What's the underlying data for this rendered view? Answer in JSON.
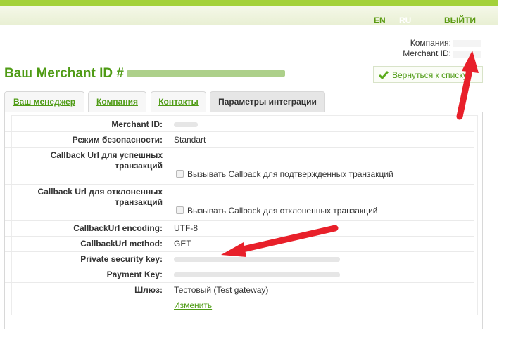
{
  "header": {
    "lang_en": "EN",
    "lang_ru": "RU",
    "logout": "ВЫЙТИ"
  },
  "account": {
    "company_label": "Компания:",
    "merchant_label": "Merchant ID:"
  },
  "page": {
    "title": "Ваш Merchant ID #"
  },
  "back_button": {
    "label": "Вернуться к списку",
    "icon": "check-icon"
  },
  "tabs": [
    {
      "label": "Ваш менеджер",
      "active": false
    },
    {
      "label": "Компания",
      "active": false
    },
    {
      "label": "Контакты",
      "active": false
    },
    {
      "label": "Параметры интеграции",
      "active": true
    }
  ],
  "fields": {
    "merchant_id": {
      "label": "Merchant ID:"
    },
    "security_mode": {
      "label": "Режим безопасности:",
      "value": "Standart"
    },
    "callback_success": {
      "label": "Callback Url для успешных транзакций",
      "checkbox_label": "Вызывать Callback для подтвержденных транзакций",
      "checked": false
    },
    "callback_fail": {
      "label": "Callback Url для отклоненных транзакций",
      "checkbox_label": "Вызывать Callback для отклоненных транзакций",
      "checked": false
    },
    "callback_encoding": {
      "label": "CallbackUrl encoding:",
      "value": "UTF-8"
    },
    "callback_method": {
      "label": "CallbackUrl method:",
      "value": "GET"
    },
    "private_key": {
      "label": "Private security key:"
    },
    "payment_key": {
      "label": "Payment Key:"
    },
    "gateway": {
      "label": "Шлюз:",
      "value": "Тестовый (Test gateway)"
    },
    "edit_link": "Изменить"
  },
  "colors": {
    "accent_green": "#4f9b15",
    "top_strip": "#a3d139",
    "annotation_red": "#e8202a"
  }
}
